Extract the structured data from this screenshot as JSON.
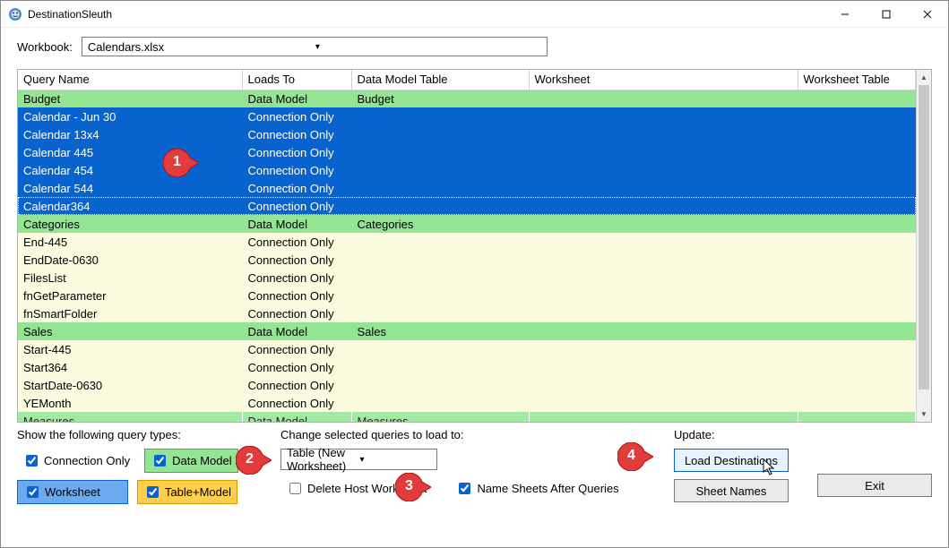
{
  "app_title": "DestinationSleuth",
  "workbook_label": "Workbook:",
  "workbook_value": "Calendars.xlsx",
  "columns": {
    "c0": "Query Name",
    "c1": "Loads To",
    "c2": "Data Model Table",
    "c3": "Worksheet",
    "c4": "Worksheet Table"
  },
  "rows": {
    "r0": {
      "q": "Budget",
      "l": "Data Model",
      "d": "Budget",
      "w": "",
      "t": ""
    },
    "r1": {
      "q": "Calendar - Jun 30",
      "l": "Connection Only",
      "d": "",
      "w": "",
      "t": ""
    },
    "r2": {
      "q": "Calendar 13x4",
      "l": "Connection Only",
      "d": "",
      "w": "",
      "t": ""
    },
    "r3": {
      "q": "Calendar 445",
      "l": "Connection Only",
      "d": "",
      "w": "",
      "t": ""
    },
    "r4": {
      "q": "Calendar 454",
      "l": "Connection Only",
      "d": "",
      "w": "",
      "t": ""
    },
    "r5": {
      "q": "Calendar 544",
      "l": "Connection Only",
      "d": "",
      "w": "",
      "t": ""
    },
    "r6": {
      "q": "Calendar364",
      "l": "Connection Only",
      "d": "",
      "w": "",
      "t": ""
    },
    "r7": {
      "q": "Categories",
      "l": "Data Model",
      "d": "Categories",
      "w": "",
      "t": ""
    },
    "r8": {
      "q": "End-445",
      "l": "Connection Only",
      "d": "",
      "w": "",
      "t": ""
    },
    "r9": {
      "q": "EndDate-0630",
      "l": "Connection Only",
      "d": "",
      "w": "",
      "t": ""
    },
    "r10": {
      "q": "FilesList",
      "l": "Connection Only",
      "d": "",
      "w": "",
      "t": ""
    },
    "r11": {
      "q": "fnGetParameter",
      "l": "Connection Only",
      "d": "",
      "w": "",
      "t": ""
    },
    "r12": {
      "q": "fnSmartFolder",
      "l": "Connection Only",
      "d": "",
      "w": "",
      "t": ""
    },
    "r13": {
      "q": "Sales",
      "l": "Data Model",
      "d": "Sales",
      "w": "",
      "t": ""
    },
    "r14": {
      "q": "Start-445",
      "l": "Connection Only",
      "d": "",
      "w": "",
      "t": ""
    },
    "r15": {
      "q": "Start364",
      "l": "Connection Only",
      "d": "",
      "w": "",
      "t": ""
    },
    "r16": {
      "q": "StartDate-0630",
      "l": "Connection Only",
      "d": "",
      "w": "",
      "t": ""
    },
    "r17": {
      "q": "YEMonth",
      "l": "Connection Only",
      "d": "",
      "w": "",
      "t": ""
    },
    "r18": {
      "q": "Measures",
      "l": "Data Model",
      "d": "Measures",
      "w": "",
      "t": ""
    }
  },
  "filter_label": "Show the following query types:",
  "filters": {
    "conn_only": "Connection Only",
    "data_model": "Data Model",
    "worksheet": "Worksheet",
    "table_model": "Table+Model"
  },
  "change_label": "Change selected queries to load to:",
  "change_value": "Table (New Worksheet)",
  "opt_delete": "Delete Host Worksheet",
  "opt_namesheets": "Name Sheets After Queries",
  "update_label": "Update:",
  "btn_load": "Load Destinations",
  "btn_sheets": "Sheet Names",
  "btn_exit": "Exit",
  "callouts": {
    "c1": "1",
    "c2": "2",
    "c3": "3",
    "c4": "4"
  }
}
